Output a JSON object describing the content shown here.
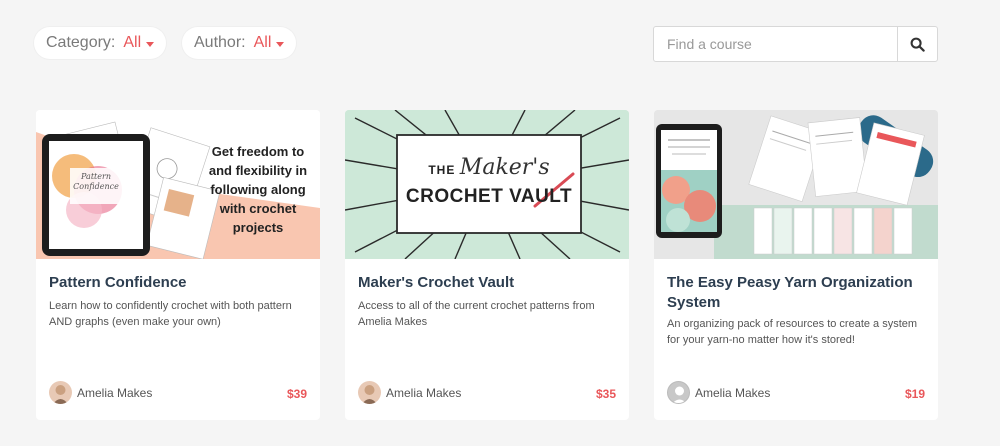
{
  "filters": {
    "category": {
      "label": "Category:",
      "value": "All"
    },
    "author": {
      "label": "Author:",
      "value": "All"
    }
  },
  "search": {
    "placeholder": "Find a course"
  },
  "courses": [
    {
      "title": "Pattern Confidence",
      "description": "Learn how to confidently crochet with both pattern AND graphs (even make your own)",
      "author": "Amelia Makes",
      "price": "$39",
      "thumbnail": {
        "headline": "Get freedom to and flexibility in following along with crochet projects",
        "tablet_title": "Pattern Confidence"
      }
    },
    {
      "title": "Maker's Crochet Vault",
      "description": "Access to all of the current crochet patterns from Amelia Makes",
      "author": "Amelia Makes",
      "price": "$35",
      "thumbnail": {
        "line1_a": "THE",
        "line1_b": "Maker's",
        "line2": "CROCHET VAULT"
      }
    },
    {
      "title": "The Easy Peasy Yarn Organization System",
      "description": "An organizing pack of resources to create a system for your yarn-no matter how it's stored!",
      "author": "Amelia Makes",
      "price": "$19"
    }
  ],
  "colors": {
    "accent": "#e9575a",
    "title": "#2d3e50",
    "page_bg": "#f5f5f5",
    "peach": "#f9c6b0",
    "mint": "#cde8d8"
  }
}
